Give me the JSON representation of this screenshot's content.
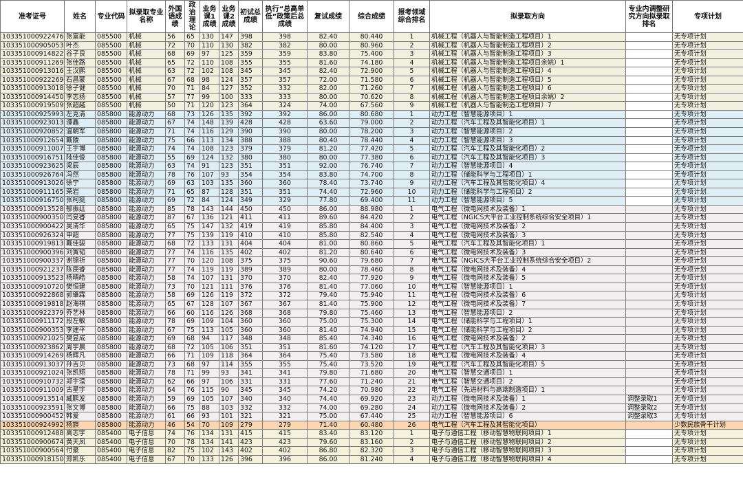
{
  "headers": [
    "准考证号",
    "姓名",
    "专业代码",
    "拟录取专业名称",
    "外国语成绩",
    "政治理论",
    "业务课1成绩",
    "业务课2成绩",
    "初试总成绩",
    "执行“总高单低”政策后总成绩",
    "复试成绩",
    "综合成绩",
    "报考领域综合排名",
    "拟录取方向",
    "专业内调整研究方向拟录取排名",
    "专项计划"
  ],
  "rows": [
    {
      "g": "mech",
      "c": [
        "10335100092247​6",
        "张富能",
        "085500",
        "机械",
        "56",
        "65",
        "130",
        "147",
        "398",
        "398",
        "82.40",
        "80.440",
        "1",
        "机械工程（机器人与智能制造工程项目）1",
        "",
        "无专项计划"
      ]
    },
    {
      "g": "mech",
      "c": [
        "103351000905053",
        "叶杰",
        "085500",
        "机械",
        "72",
        "70",
        "110",
        "130",
        "382",
        "382",
        "80.00",
        "80.960",
        "2",
        "机械工程（机器人与智能制造工程项目）2",
        "",
        "无专项计划"
      ]
    },
    {
      "g": "mech",
      "c": [
        "103351000914822",
        "谷子良",
        "085500",
        "机械",
        "68",
        "69",
        "97",
        "125",
        "359",
        "359",
        "83.80",
        "75.400",
        "3",
        "机械工程（机器人与智能制造工程项目）3",
        "",
        "无专项计划"
      ]
    },
    {
      "g": "mech",
      "c": [
        "103351000911269",
        "张佳路",
        "085500",
        "机械",
        "65",
        "72",
        "110",
        "108",
        "355",
        "355",
        "81.60",
        "74.180",
        "4",
        "机械工程（机器人与智能制造工程项目余姚）1",
        "",
        "无专项计划"
      ]
    },
    {
      "g": "mech",
      "c": [
        "103351000913016",
        "王汉鹏",
        "085500",
        "机械",
        "63",
        "72",
        "102",
        "108",
        "345",
        "345",
        "82.40",
        "72.900",
        "5",
        "机械工程（机器人与智能制造工程项目）4",
        "",
        "无专项计划"
      ]
    },
    {
      "g": "mech",
      "c": [
        "103351000922269",
        "石昌蒙",
        "085500",
        "机械",
        "67",
        "68",
        "98",
        "124",
        "357",
        "357",
        "72.00",
        "71.580",
        "6",
        "机械工程（机器人与智能制造工程项目）5",
        "",
        "无专项计划"
      ]
    },
    {
      "g": "mech",
      "c": [
        "103351000913018",
        "徐子健",
        "085500",
        "机械",
        "70",
        "71",
        "84",
        "127",
        "352",
        "332",
        "82.00",
        "71.260",
        "7",
        "机械工程（机器人与智能制造工程项目）6",
        "",
        "无专项计划"
      ]
    },
    {
      "g": "mech",
      "c": [
        "103351000914450",
        "李志扬",
        "085500",
        "机械",
        "57",
        "77",
        "99",
        "100",
        "333",
        "333",
        "80.00",
        "70.620",
        "8",
        "机械工程（机器人与智能制造工程项目余姚）2",
        "",
        "无专项计划"
      ]
    },
    {
      "g": "mech",
      "c": [
        "103351000919509",
        "张超越",
        "085500",
        "机械",
        "50",
        "71",
        "120",
        "123",
        "364",
        "324",
        "74.00",
        "67.560",
        "9",
        "机械工程（机器人与智能制造工程项目）7",
        "",
        "无专项计划"
      ]
    },
    {
      "g": "pow",
      "c": [
        "103351000925993",
        "左克清",
        "085800",
        "能源动力",
        "68",
        "73",
        "126",
        "135",
        "392",
        "392",
        "86.00",
        "80.680",
        "1",
        "动力工程（智慧能源项目）1",
        "",
        "无专项计划"
      ]
    },
    {
      "g": "pow",
      "c": [
        "103351000923013",
        "谭鑫",
        "085800",
        "能源动力",
        "67",
        "74",
        "148",
        "139",
        "428",
        "428",
        "63.60",
        "79.000",
        "2",
        "动力工程（汽车工程及其智能化项目）1",
        "",
        "无专项计划"
      ]
    },
    {
      "g": "pow",
      "c": [
        "103351000920852",
        "温朝军",
        "085800",
        "能源动力",
        "71",
        "74",
        "116",
        "129",
        "390",
        "390",
        "80.00",
        "78.200",
        "3",
        "动力工程（智慧能源项目）2",
        "",
        "无专项计划"
      ]
    },
    {
      "g": "pow",
      "c": [
        "103351000912654",
        "戴陵",
        "085800",
        "能源动力",
        "75",
        "66",
        "113",
        "134",
        "388",
        "388",
        "80.40",
        "78.440",
        "4",
        "动力工程（智慧能源项目）3",
        "",
        "无专项计划"
      ]
    },
    {
      "g": "pow",
      "c": [
        "103351000911007",
        "王宇博",
        "085800",
        "能源动力",
        "74",
        "74",
        "108",
        "123",
        "379",
        "379",
        "81.20",
        "77.420",
        "5",
        "动力工程（汽车工程及其智能化项目）2",
        "",
        "无专项计划"
      ]
    },
    {
      "g": "pow",
      "c": [
        "103351000916751",
        "陆佳俊",
        "085800",
        "能源动力",
        "55",
        "69",
        "124",
        "132",
        "380",
        "380",
        "80.00",
        "77.380",
        "6",
        "动力工程（汽车工程及其智能化项目）3",
        "",
        "无专项计划"
      ]
    },
    {
      "g": "pow",
      "c": [
        "103351000923625",
        "梁辰",
        "085800",
        "能源动力",
        "63",
        "74",
        "91",
        "123",
        "351",
        "351",
        "92.00",
        "76.740",
        "7",
        "动力工程（智慧能源项目）4",
        "",
        "无专项计划"
      ]
    },
    {
      "g": "pow",
      "c": [
        "103351000926764",
        "冯然",
        "085800",
        "能源动力",
        "78",
        "76",
        "107",
        "93",
        "354",
        "354",
        "83.80",
        "74.700",
        "8",
        "动力工程（储能科学与工程项目）1",
        "",
        "无专项计划"
      ]
    },
    {
      "g": "pow",
      "c": [
        "103351000913026",
        "徐宁",
        "085800",
        "能源动力",
        "69",
        "63",
        "103",
        "135",
        "360",
        "360",
        "78.40",
        "73.740",
        "9",
        "动力工程（汽车工程及其智能化项目）4",
        "",
        "无专项计划"
      ]
    },
    {
      "g": "pow",
      "c": [
        "103351000911165",
        "荣岩",
        "085800",
        "能源动力",
        "71",
        "65",
        "87",
        "128",
        "351",
        "351",
        "74.40",
        "72.960",
        "10",
        "动力工程（储能科学与工程项目）2",
        "",
        "无专项计划"
      ]
    },
    {
      "g": "pow",
      "c": [
        "103351000916750",
        "张柯挺",
        "085800",
        "能源动力",
        "69",
        "72",
        "84",
        "124",
        "349",
        "329",
        "77.80",
        "69.400",
        "11",
        "动力工程（智慧能源项目）5",
        "",
        "无专项计划"
      ]
    },
    {
      "g": "elec",
      "c": [
        "103351000913528",
        "郁振廷",
        "085800",
        "能源动力",
        "85",
        "78",
        "143",
        "144",
        "450",
        "450",
        "86.00",
        "88.980",
        "1",
        "电气工程（微电网技术及装备）1",
        "",
        "无专项计划"
      ]
    },
    {
      "g": "elec",
      "c": [
        "103351000900350",
        "闫旻睿",
        "085800",
        "能源动力",
        "87",
        "67",
        "136",
        "121",
        "411",
        "411",
        "89.60",
        "84.420",
        "2",
        "电气工程（NGICS大平台工业控制系统综合安全项目）1",
        "",
        "无专项计划"
      ]
    },
    {
      "g": "elec",
      "c": [
        "103351000900422",
        "吴清华",
        "085800",
        "能源动力",
        "65",
        "75",
        "147",
        "132",
        "419",
        "419",
        "85.80",
        "84.400",
        "3",
        "电气工程（微电网技术及装备）2",
        "",
        "无专项计划"
      ]
    },
    {
      "g": "elec",
      "c": [
        "103351000926324",
        "申超",
        "085800",
        "能源动力",
        "77",
        "75",
        "139",
        "119",
        "410",
        "410",
        "85.80",
        "82.540",
        "4",
        "电气工程（微电网技术及装备）3",
        "",
        "无专项计划"
      ]
    },
    {
      "g": "elec",
      "c": [
        "103351000919813",
        "戴佳骏",
        "085800",
        "能源动力",
        "68",
        "72",
        "133",
        "131",
        "404",
        "404",
        "81.00",
        "80.860",
        "5",
        "电气工程（汽车工程及其智能化项目）1",
        "",
        "无专项计划"
      ]
    },
    {
      "g": "elec",
      "c": [
        "103351000900396",
        "刘寅韬",
        "085800",
        "能源动力",
        "77",
        "74",
        "116",
        "135",
        "402",
        "402",
        "81.20",
        "80.640",
        "6",
        "电气工程（微电网技术及装备）3",
        "",
        "无专项计划"
      ]
    },
    {
      "g": "elec",
      "c": [
        "103351000900337",
        "谢锦祈",
        "085800",
        "能源动力",
        "77",
        "70",
        "120",
        "108",
        "375",
        "375",
        "90.60",
        "79.680",
        "7",
        "电气工程（NGICS大平台工业控制系统综合安全项目）2",
        "",
        "无专项计划"
      ]
    },
    {
      "g": "elec",
      "c": [
        "103351000921237",
        "陈庚睿",
        "085800",
        "能源动力",
        "77",
        "74",
        "119",
        "119",
        "389",
        "389",
        "80.00",
        "78.460",
        "8",
        "电气工程（微电网技术及装备）4",
        "",
        "无专项计划"
      ]
    },
    {
      "g": "elec",
      "c": [
        "103351000913523",
        "杨晴皓",
        "085800",
        "能源动力",
        "58",
        "74",
        "107",
        "131",
        "370",
        "370",
        "82.40",
        "77.920",
        "9",
        "电气工程（微电网技术及装备）5",
        "",
        "无专项计划"
      ]
    },
    {
      "g": "elec",
      "c": [
        "103351000910720",
        "樊恒建",
        "085800",
        "能源动力",
        "73",
        "70",
        "121",
        "111",
        "376",
        "376",
        "81.40",
        "77.060",
        "10",
        "电气工程（智慧能源项目）1",
        "",
        "无专项计划"
      ]
    },
    {
      "g": "elec",
      "c": [
        "103351000922868",
        "郭肇霖",
        "085800",
        "能源动力",
        "58",
        "69",
        "126",
        "119",
        "372",
        "372",
        "79.40",
        "75.940",
        "11",
        "电气工程（微电网技术及装备）6",
        "",
        "无专项计划"
      ]
    },
    {
      "g": "elec",
      "c": [
        "103351000919818",
        "赵海祺",
        "085800",
        "能源动力",
        "65",
        "67",
        "128",
        "107",
        "367",
        "367",
        "81.40",
        "75.900",
        "12",
        "电气工程（微电网技术及装备）7",
        "",
        "无专项计划"
      ]
    },
    {
      "g": "elec",
      "c": [
        "103351000922379",
        "乔艺林",
        "085800",
        "能源动力",
        "66",
        "60",
        "116",
        "126",
        "368",
        "368",
        "79.80",
        "75.460",
        "13",
        "电气工程（智慧能源项目）2",
        "",
        "无专项计划"
      ]
    },
    {
      "g": "elec",
      "c": [
        "103351000911172",
        "段左敏",
        "085800",
        "能源动力",
        "78",
        "69",
        "109",
        "104",
        "360",
        "360",
        "75.00",
        "75.300",
        "14",
        "电气工程（储能科学与工程项目）1",
        "",
        "无专项计划"
      ]
    },
    {
      "g": "elec",
      "c": [
        "103351000900353",
        "李建平",
        "085800",
        "能源动力",
        "67",
        "75",
        "113",
        "105",
        "360",
        "360",
        "81.40",
        "74.940",
        "15",
        "电气工程（储能科学与工程项目）2",
        "",
        "无专项计划"
      ]
    },
    {
      "g": "elec",
      "c": [
        "103351000921025",
        "樊昱成",
        "085800",
        "能源动力",
        "69",
        "68",
        "94",
        "117",
        "348",
        "348",
        "85.40",
        "74.340",
        "16",
        "电气工程（微电网技术及装备）2",
        "",
        "无专项计划"
      ]
    },
    {
      "g": "elec",
      "c": [
        "103351000923862",
        "周宇晨",
        "085800",
        "能源动力",
        "68",
        "72",
        "105",
        "106",
        "351",
        "351",
        "81.60",
        "74.120",
        "17",
        "电气工程（汽车工程及其智能化项目）3",
        "",
        "无专项计划"
      ]
    },
    {
      "g": "elec",
      "c": [
        "103351000914269",
        "杨辉凡",
        "085800",
        "能源动力",
        "66",
        "71",
        "109",
        "118",
        "364",
        "364",
        "75.40",
        "73.580",
        "18",
        "电气工程（微电网技术及装备）4",
        "",
        "无专项计划"
      ]
    },
    {
      "g": "elec",
      "c": [
        "103351000913037",
        "孙吉贝",
        "085800",
        "能源动力",
        "73",
        "68",
        "97",
        "114",
        "355",
        "355",
        "75.40",
        "73.520",
        "19",
        "电气工程（汽车工程及其智能化项目）5",
        "",
        "无专项计划"
      ]
    },
    {
      "g": "elec",
      "c": [
        "103351000921024",
        "张凯翔",
        "085800",
        "能源动力",
        "78",
        "71",
        "99",
        "93",
        "341",
        "341",
        "79.80",
        "71.680",
        "20",
        "电气工程（智慧交通项目）1",
        "",
        "无专项计划"
      ]
    },
    {
      "g": "elec",
      "c": [
        "103351000910732",
        "郑宇滢",
        "085800",
        "能源动力",
        "62",
        "66",
        "97",
        "106",
        "331",
        "331",
        "77.60",
        "71.240",
        "21",
        "电气工程（智慧交通项目）2",
        "",
        "无专项计划"
      ]
    },
    {
      "g": "elec",
      "c": [
        "103351000911009",
        "古星宇",
        "085800",
        "能源动力",
        "64",
        "76",
        "115",
        "90",
        "345",
        "345",
        "74.20",
        "70.980",
        "22",
        "电气工程（先进材料与高端制造项目）1",
        "",
        "无专项计划"
      ]
    },
    {
      "g": "elec",
      "c": [
        "103351000913514",
        "臧鹏发",
        "085800",
        "能源动力",
        "59",
        "69",
        "105",
        "107",
        "340",
        "340",
        "74.40",
        "69.920",
        "23",
        "动力工程（微电网技术及装备）1",
        "调整录取1",
        "无专项计划"
      ]
    },
    {
      "g": "elec",
      "c": [
        "103351000923591",
        "张文博",
        "085800",
        "能源动力",
        "66",
        "75",
        "88",
        "103",
        "332",
        "332",
        "74.00",
        "69.280",
        "24",
        "动力工程（微电网技术及装备）2",
        "调整录取2",
        "无专项计划"
      ]
    },
    {
      "g": "elec",
      "c": [
        "103351000900452",
        "韩爱",
        "085800",
        "能源动力",
        "61",
        "66",
        "93",
        "101",
        "321",
        "321",
        "75.00",
        "67.440",
        "25",
        "动力工程（智慧能源项目）6",
        "调整录取3",
        "无专项计划"
      ]
    },
    {
      "g": "minor",
      "c": [
        "103351000924992",
        "杨旗",
        "085800",
        "能源动力",
        "46",
        "54",
        "70",
        "109",
        "279",
        "279",
        "71.40",
        "60.480",
        "26",
        "电气工程（汽车工程及其智能化项目）",
        "",
        "少数民族骨干计划"
      ]
    },
    {
      "g": "comm",
      "c": [
        "103351000912488",
        "高志宇",
        "085400",
        "电子信息",
        "74",
        "76",
        "134",
        "131",
        "415",
        "415",
        "83.40",
        "83.120",
        "1",
        "电子与通信工程（移动智慧物联网项目）1",
        "",
        "无专项计划"
      ]
    },
    {
      "g": "comm",
      "c": [
        "103351000900674",
        "黄天凤",
        "085400",
        "电子信息",
        "70",
        "78",
        "134",
        "141",
        "423",
        "423",
        "79.60",
        "83.160",
        "2",
        "电子与通信工程（移动智慧物联网项目）2",
        "",
        "无专项计划"
      ]
    },
    {
      "g": "comm",
      "c": [
        "103351000900564",
        "付豪",
        "085400",
        "电子信息",
        "82",
        "75",
        "102",
        "143",
        "402",
        "402",
        "86.80",
        "82.320",
        "3",
        "电子与通信工程（移动智慧物联网项目）3",
        "",
        "无专项计划"
      ]
    },
    {
      "g": "comm",
      "c": [
        "103351000918150",
        "郑凯乐",
        "085400",
        "电子信息",
        "67",
        "70",
        "133",
        "126",
        "396",
        "396",
        "86.00",
        "81.240",
        "4",
        "电子与通信工程（移动智慧物联网项目）4",
        "",
        "无专项计划"
      ]
    }
  ]
}
